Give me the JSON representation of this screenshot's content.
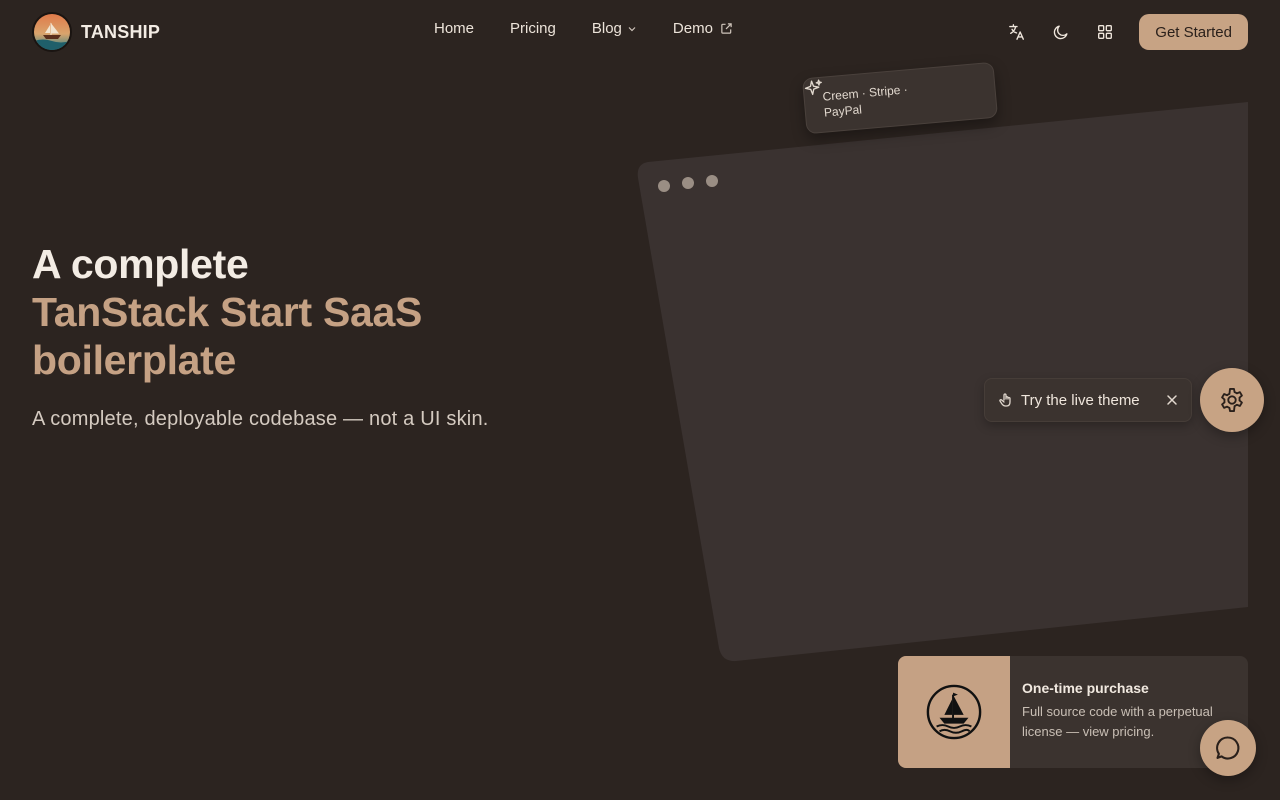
{
  "brand": {
    "name": "TANSHIP"
  },
  "nav": {
    "items": [
      {
        "label": "Home"
      },
      {
        "label": "Pricing"
      },
      {
        "label": "Blog"
      },
      {
        "label": "Demo"
      }
    ]
  },
  "header": {
    "icons": [
      "translate-icon",
      "moon-icon",
      "grid-icon"
    ],
    "cta_label": "Get Started"
  },
  "hero": {
    "title_line1": "A complete",
    "title_line2": "TanStack Start SaaS",
    "title_line3": "boilerplate",
    "subtitle": "A complete, deployable codebase — not a UI skin."
  },
  "float_card": {
    "text": "Creem · Stripe · PayPal"
  },
  "toast": {
    "label": "Try the live theme"
  },
  "promo": {
    "title": "One-time purchase",
    "description": "Full source code with a perpetual license — view pricing."
  },
  "colors": {
    "background": "#2c2420",
    "accent": "#c7a384",
    "accent_text": "#c5a184",
    "card": "#3b332f"
  }
}
